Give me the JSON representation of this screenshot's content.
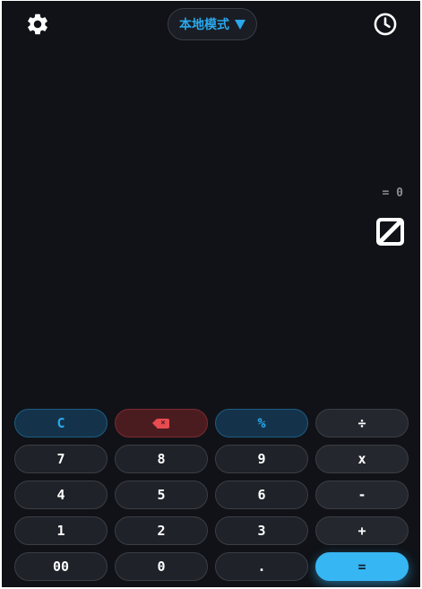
{
  "header": {
    "settings_icon": "gear-icon",
    "mode_label": "本地模式",
    "history_icon": "clock-icon"
  },
  "display": {
    "expression": "= 0",
    "result": "0"
  },
  "keypad": {
    "rows": [
      [
        {
          "label": "C",
          "style": "c-blue"
        },
        {
          "label": "⌫",
          "style": "c-red",
          "icon": "backspace-icon"
        },
        {
          "label": "%",
          "style": "c-blue"
        },
        {
          "label": "÷",
          "style": "op"
        }
      ],
      [
        {
          "label": "7"
        },
        {
          "label": "8"
        },
        {
          "label": "9"
        },
        {
          "label": "x",
          "style": "op"
        }
      ],
      [
        {
          "label": "4"
        },
        {
          "label": "5"
        },
        {
          "label": "6"
        },
        {
          "label": "-",
          "style": "op"
        }
      ],
      [
        {
          "label": "1"
        },
        {
          "label": "2"
        },
        {
          "label": "3"
        },
        {
          "label": "+",
          "style": "op"
        }
      ],
      [
        {
          "label": "00"
        },
        {
          "label": "0"
        },
        {
          "label": "."
        },
        {
          "label": "=",
          "style": "equals"
        }
      ]
    ]
  },
  "colors": {
    "background": "#101217",
    "accent": "#2aa8ec",
    "equals": "#37b6f4",
    "danger": "#e84b50"
  }
}
